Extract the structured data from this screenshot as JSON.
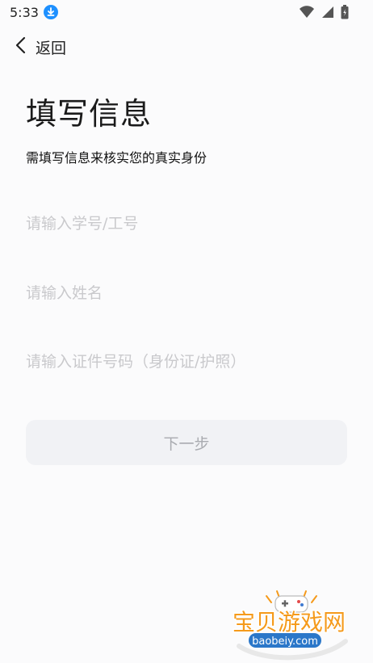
{
  "status_bar": {
    "time": "5:33"
  },
  "nav": {
    "back_label": "返回"
  },
  "form": {
    "title": "填写信息",
    "subtitle": "需填写信息来核实您的真实身份",
    "fields": [
      {
        "placeholder": "请输入学号/工号",
        "value": ""
      },
      {
        "placeholder": "请输入姓名",
        "value": ""
      },
      {
        "placeholder": "请输入证件号码（身份证/护照）",
        "value": ""
      }
    ],
    "next_button": "下一步"
  },
  "watermark": {
    "brand_cn": "宝贝游戏网",
    "brand_url": "baobeiy.com"
  },
  "colors": {
    "background": "#fbfbfc",
    "button_bg": "#f1f2f5",
    "button_text": "#a9abb0",
    "placeholder": "#c9c9cc",
    "download_icon": "#1e90ff",
    "watermark_orange": "#f59a1b",
    "watermark_blue": "#2b77c9"
  },
  "icons": {
    "status": [
      "download-icon",
      "wifi-icon",
      "signal-icon",
      "battery-icon"
    ],
    "nav": "chevron-left-icon"
  }
}
